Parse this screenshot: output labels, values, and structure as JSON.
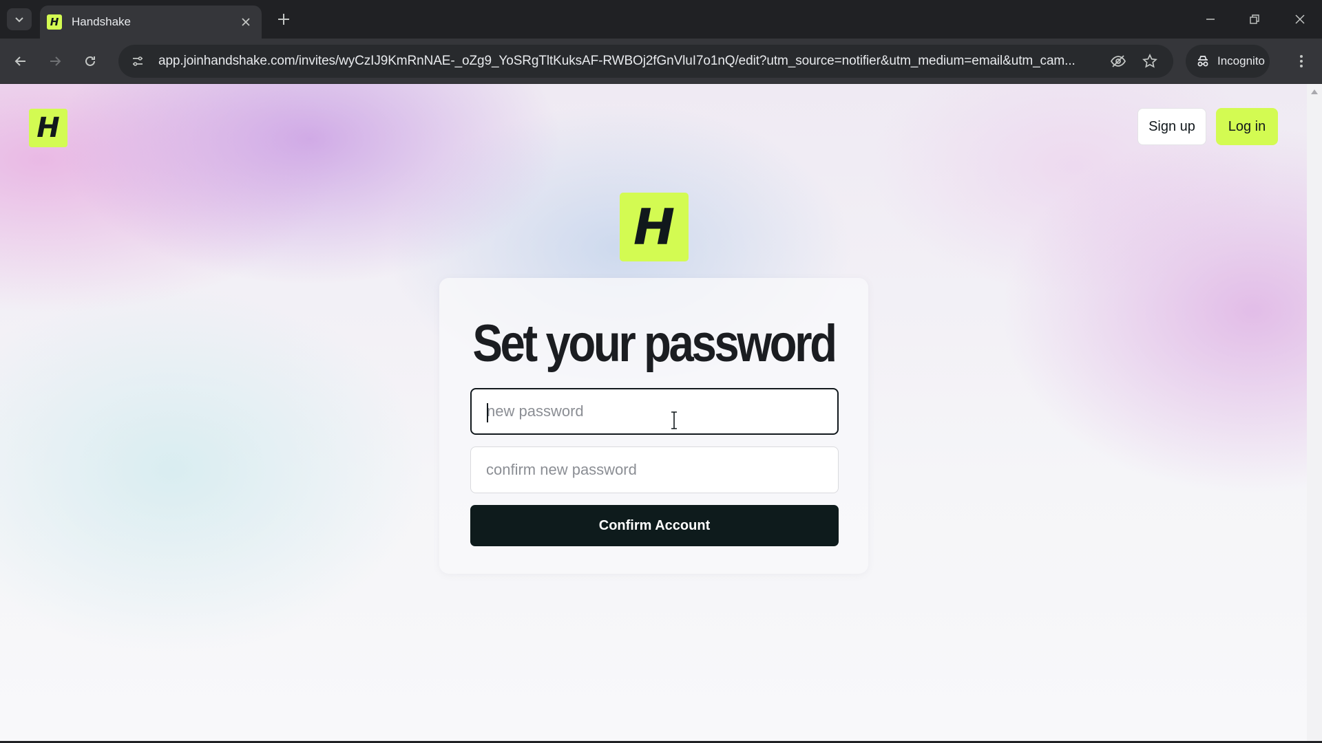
{
  "browser": {
    "tab": {
      "title": "Handshake",
      "favicon_letter": "H"
    },
    "url": "app.joinhandshake.com/invites/wyCzIJ9KmRnNAE-_oZg9_YoSRgTltKuksAF-RWBOj2fGnVluI7o1nQ/edit?utm_source=notifier&utm_medium=email&utm_cam...",
    "incognito_label": "Incognito",
    "icons": {
      "tab_search": "chevron-down-icon",
      "tab_close": "close-icon",
      "new_tab": "plus-icon",
      "minimize": "minimize-icon",
      "restore": "restore-icon",
      "close_window": "close-window-icon",
      "back": "back-arrow-icon",
      "forward": "forward-arrow-icon",
      "reload": "reload-icon",
      "site_info": "tune-icon",
      "tracking": "eye-off-icon",
      "bookmark": "star-icon",
      "incognito": "incognito-icon",
      "menu": "kebab-menu-icon"
    }
  },
  "header": {
    "logo_letter": "H",
    "signup_label": "Sign up",
    "login_label": "Log in"
  },
  "main": {
    "logo_letter": "H",
    "title": "Set your password",
    "new_password_placeholder": "new password",
    "confirm_password_placeholder": "confirm new password",
    "confirm_button_label": "Confirm Account"
  },
  "colors": {
    "brand_lime": "#d3fb52",
    "button_dark": "#0e1b1c",
    "text_dark": "#1b1d21"
  }
}
